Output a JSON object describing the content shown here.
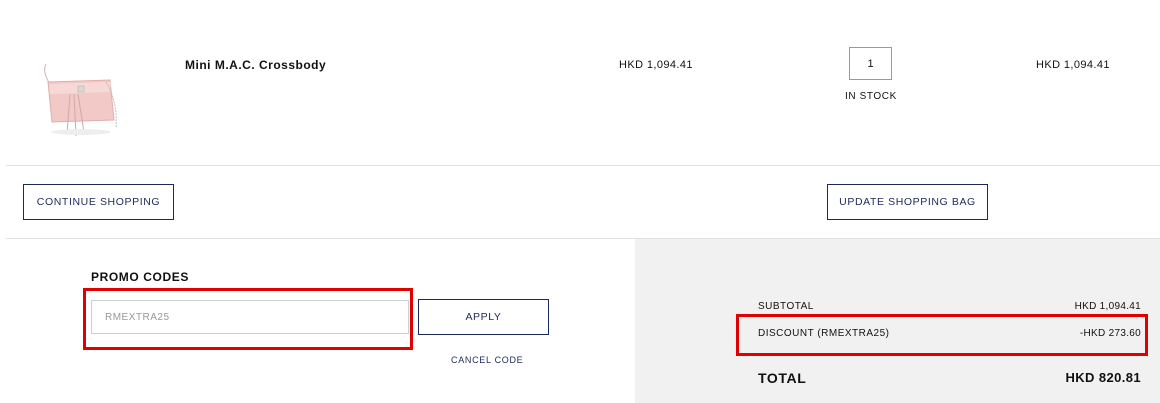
{
  "product": {
    "name": "Mini M.A.C. Crossbody",
    "unit_price": "HKD 1,094.41",
    "quantity": "1",
    "stock_status": "IN STOCK",
    "line_total": "HKD 1,094.41",
    "image_icon": "crossbody-bag-image",
    "image_color": "#f2c9c7"
  },
  "actions": {
    "continue_shopping": "CONTINUE SHOPPING",
    "update_bag": "UPDATE SHOPPING BAG"
  },
  "promo": {
    "heading": "PROMO CODES",
    "code_value": "RMEXTRA25",
    "apply_label": "APPLY",
    "cancel_label": "CANCEL CODE"
  },
  "summary": {
    "subtotal_label": "SUBTOTAL",
    "subtotal_value": "HKD 1,094.41",
    "discount_label": "DISCOUNT (RMEXTRA25)",
    "discount_value": "-HKD 273.60",
    "total_label": "TOTAL",
    "total_value": "HKD 820.81"
  },
  "colors": {
    "accent": "#1c2a5a",
    "highlight": "#e00000",
    "panel_bg": "#f1f1f1"
  }
}
